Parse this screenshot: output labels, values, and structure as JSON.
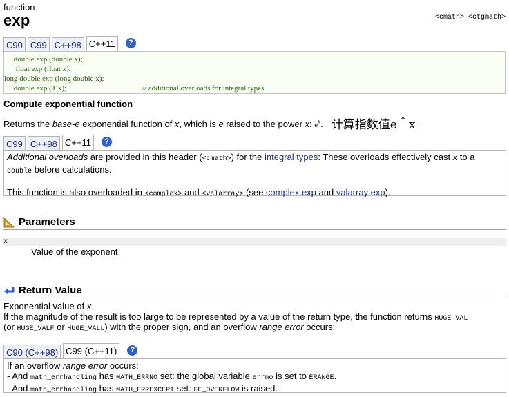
{
  "header": {
    "kind": "function",
    "title": "exp",
    "headers": "<cmath> <ctgmath>"
  },
  "tabs_top": [
    "C90",
    "C99",
    "C++98",
    "C++11"
  ],
  "tabs_top_active": "C++11",
  "help": "?",
  "prototypes": [
    {
      "code": "     double exp (double x);",
      "comment": ""
    },
    {
      "code": "      float exp (float x);",
      "comment": ""
    },
    {
      "code": "long double exp (long double x);",
      "comment": ""
    },
    {
      "code": "     double exp (T x);",
      "comment": "// additional overloads for integral types"
    }
  ],
  "subtitle": "Compute exponential function",
  "description": {
    "pre": "Returns the ",
    "base_e": "base-e",
    "mid": " exponential function of ",
    "x": "x",
    "mid2": ", which is ",
    "e": "e",
    "post": " raised to the power ",
    "x2": "x",
    "colon": ": ",
    "ex": "e",
    "sup": "x",
    "dot": ".",
    "chinese": "计算指数值e＾x"
  },
  "tabs_mid": [
    "C99",
    "C++98",
    "C++11"
  ],
  "tabs_mid_active": "C++11",
  "overloads": {
    "l1a": "Additional overloads",
    "l1b": " are provided in this header (",
    "l1code": "<cmath>",
    "l1c": ") for the ",
    "l1link": "integral types",
    "l1d": ": These overloads effectively cast ",
    "l1x": "x",
    "l1e": " to a",
    "l2code": "double",
    "l2": " before calculations.",
    "l3a": "This function is also overloaded in ",
    "l3code1": "<complex>",
    "l3b": " and ",
    "l3code2": "<valarray>",
    "l3c": " (see ",
    "l3link1": "complex exp",
    "l3d": " and ",
    "l3link2": "valarray exp",
    "l3e": ")."
  },
  "parameters": {
    "heading": "Parameters",
    "name": "x",
    "desc": "Value of the exponent."
  },
  "return_value": {
    "heading": "Return Value",
    "l1a": "Exponential value of ",
    "l1x": "x",
    "l1b": ".",
    "l2a": "If the magnitude of the result is too large to be represented by a value of the return type, the function returns ",
    "l2code": "HUGE_VAL",
    "l3a": "(or ",
    "l3code1": "HUGE_VALF",
    "l3b": " or ",
    "l3code2": "HUGE_VALL",
    "l3c": ") with the proper sign, and an overflow ",
    "l3i": "range error",
    "l3d": " occurs:"
  },
  "tabs_bottom": [
    "C90 (C++98)",
    "C99 (C++11)"
  ],
  "tabs_bottom_active": "C99 (C++11)",
  "errors": {
    "l1a": "If an overflow ",
    "l1i": "range error",
    "l1b": " occurs:",
    "l2a": "- And ",
    "l2code1": "math_errhandling",
    "l2b": " has ",
    "l2code2": "MATH_ERRNO",
    "l2c": " set: the global variable ",
    "l2code3": "errno",
    "l2d": " is set to ",
    "l2code4": "ERANGE",
    "l2e": ".",
    "l3a": "- And ",
    "l3code1": "math_errhandling",
    "l3b": " has ",
    "l3code2": "MATH_ERREXCEPT",
    "l3c": " set: ",
    "l3code3": "FE_OVERFLOW",
    "l3d": " is raised."
  }
}
